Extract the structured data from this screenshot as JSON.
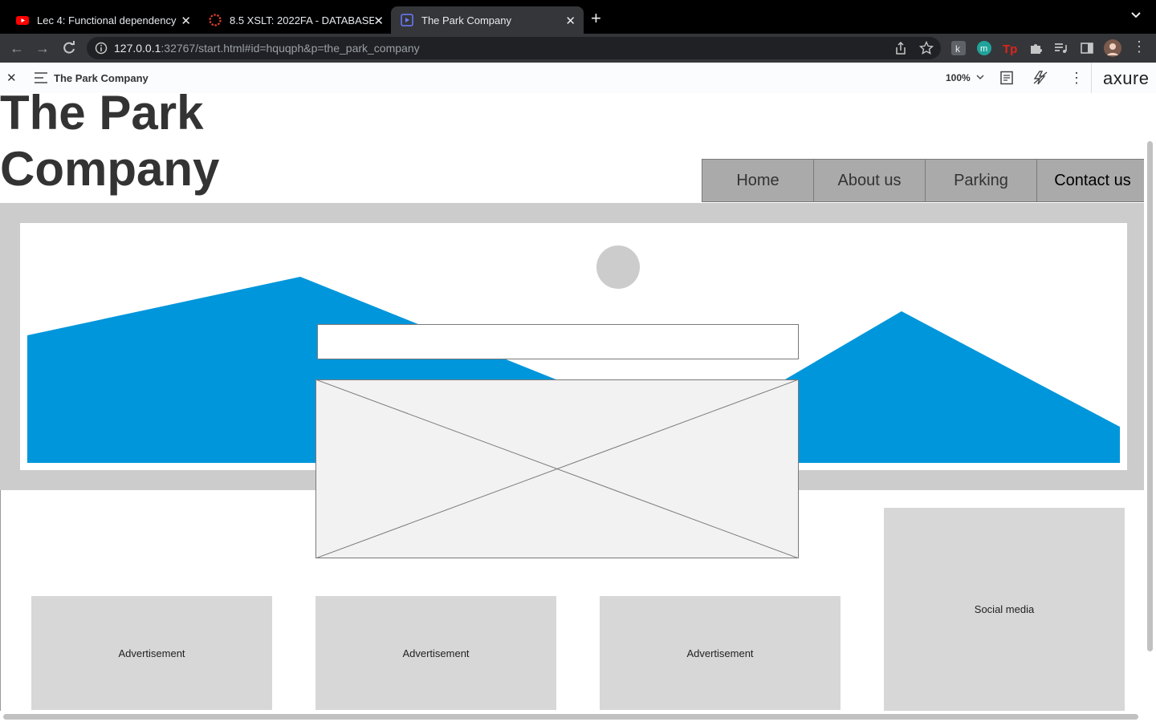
{
  "browser": {
    "tabs": [
      {
        "title": "Lec 4: Functional dependency",
        "icon": "youtube-icon"
      },
      {
        "title": "8.5 XSLT: 2022FA - DATABASE",
        "icon": "canvas-icon"
      },
      {
        "title": "The Park Company",
        "icon": "axure-icon"
      }
    ],
    "url_host": "127.0.0.1",
    "url_rest": ":32767/start.html#id=hquqph&p=the_park_company"
  },
  "axure": {
    "page_title": "The Park Company",
    "zoom": "100%",
    "logo": "axure"
  },
  "site": {
    "title": "The Park Company",
    "nav": [
      "Home",
      "About us",
      "Parking",
      "Contact us"
    ],
    "ads": [
      "Advertisement",
      "Advertisement",
      "Advertisement"
    ],
    "social": "Social media"
  },
  "colors": {
    "mountain": "#0096db",
    "hero_bg": "#cccccc",
    "nav_bg": "#aaaaaa",
    "ad_bg": "#d7d7d7"
  }
}
